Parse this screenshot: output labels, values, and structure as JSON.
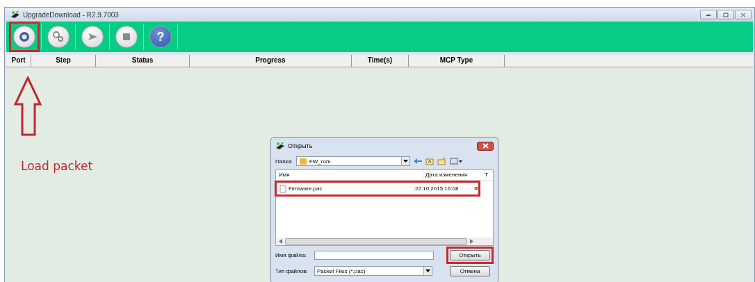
{
  "window": {
    "title": "UpgradeDownload - R2.9.7003"
  },
  "toolbar": [
    {
      "kind": "settings",
      "highlighted": true
    },
    {
      "kind": "gears",
      "highlighted": false
    },
    {
      "kind": "play",
      "highlighted": false
    },
    {
      "kind": "stop",
      "highlighted": false
    },
    {
      "kind": "help",
      "label": "?",
      "highlighted": false
    }
  ],
  "table": {
    "columns": [
      "Port",
      "Step",
      "Status",
      "Progress",
      "Time(s)",
      "MCP Type"
    ]
  },
  "annotation": {
    "text": "Load packet"
  },
  "dialog": {
    "title": "Открыть",
    "folder_label": "Папка:",
    "folder": "FW_rom",
    "columns": [
      "Имя",
      "Дата изменения",
      "Т"
    ],
    "files": [
      {
        "name": "Firmware.pac",
        "date": "22.10.2015 16:08",
        "type": "Ф",
        "highlighted": true
      }
    ],
    "filename_label": "Имя файла:",
    "filetype_label": "Тип файлов:",
    "filetype": "Packet Files (*.pac)",
    "buttons": [
      {
        "label": "Открыть",
        "highlighted": true
      },
      {
        "label": "Отмена",
        "highlighted": false
      }
    ]
  }
}
